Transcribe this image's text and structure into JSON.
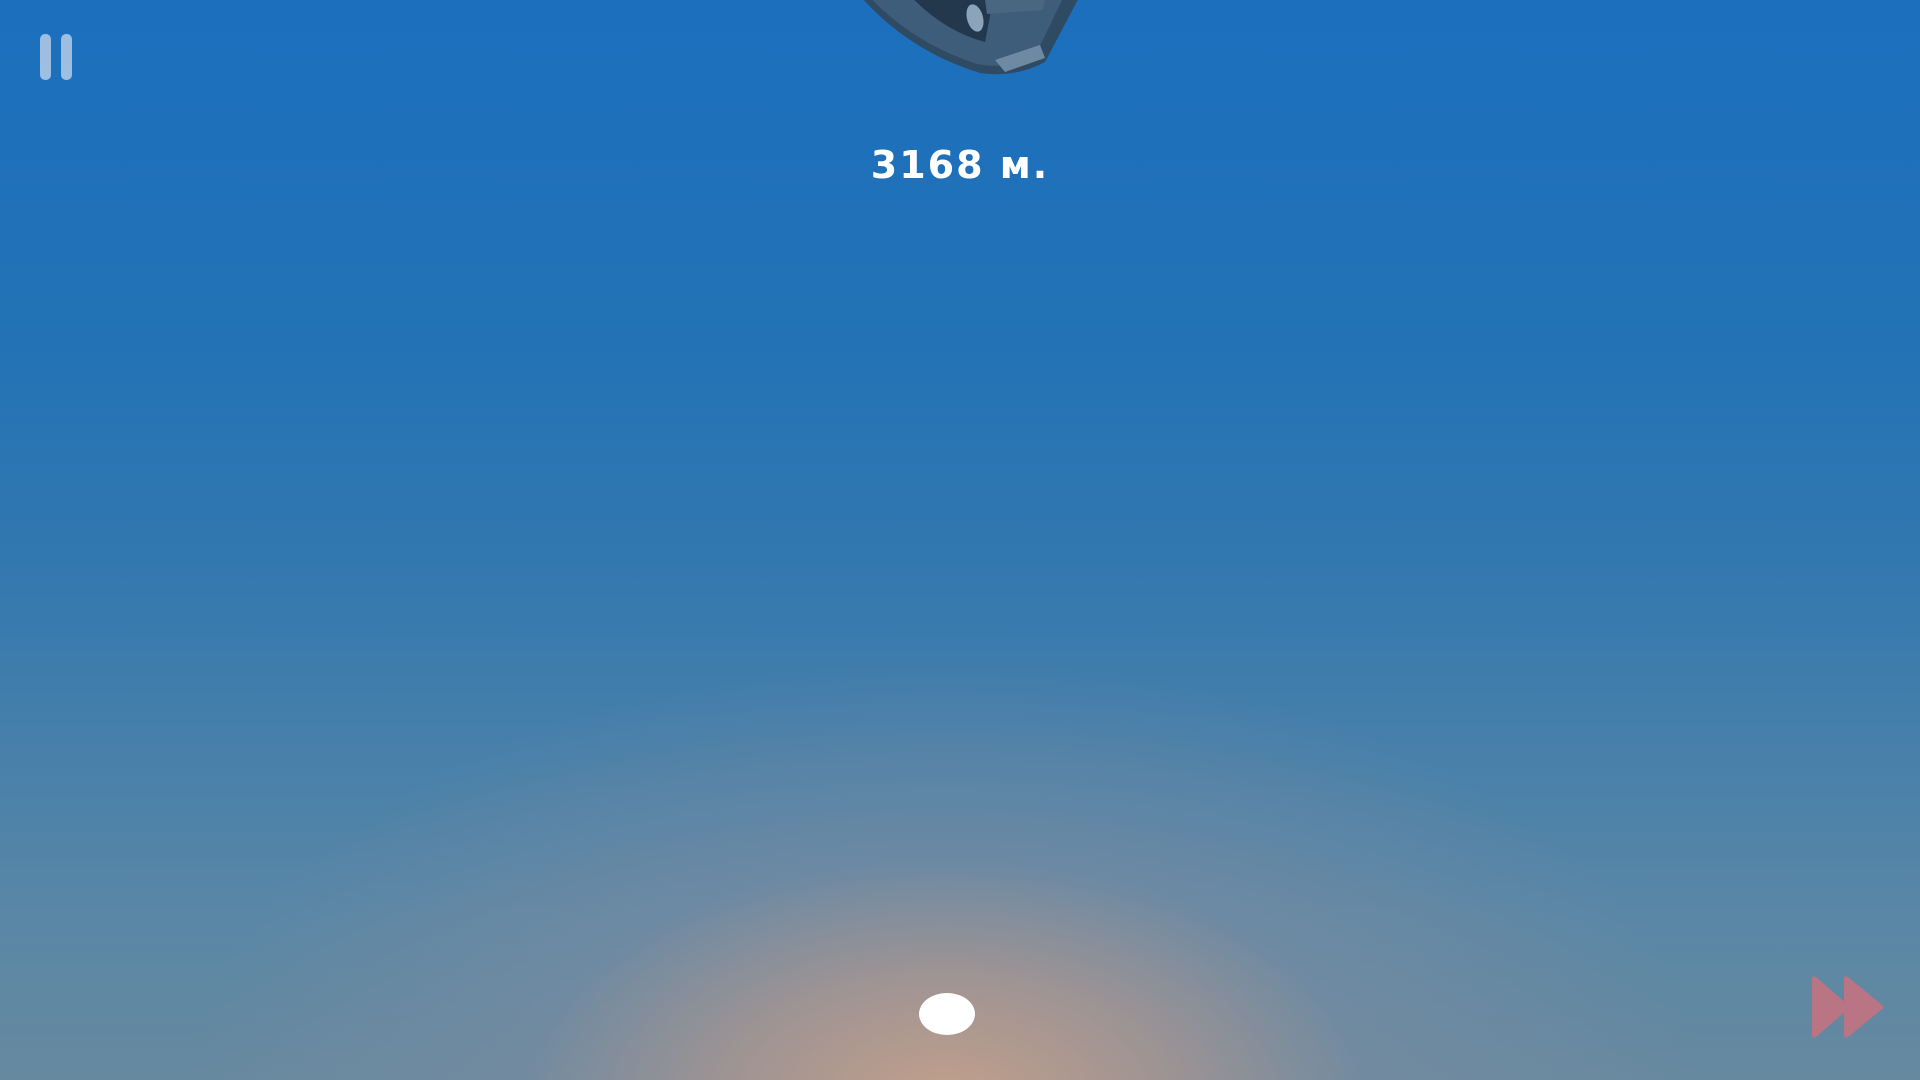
{
  "hud": {
    "distance_text": "3168 м.",
    "pause_icon": "pause-icon",
    "fast_forward_icon": "fast-forward-icon"
  },
  "colors": {
    "sky_top": "#1b6fbd",
    "horizon_glow": "#c4a08a",
    "text": "#ffffff",
    "pause": "#b4cde8",
    "fast_forward": "#c9727f"
  }
}
